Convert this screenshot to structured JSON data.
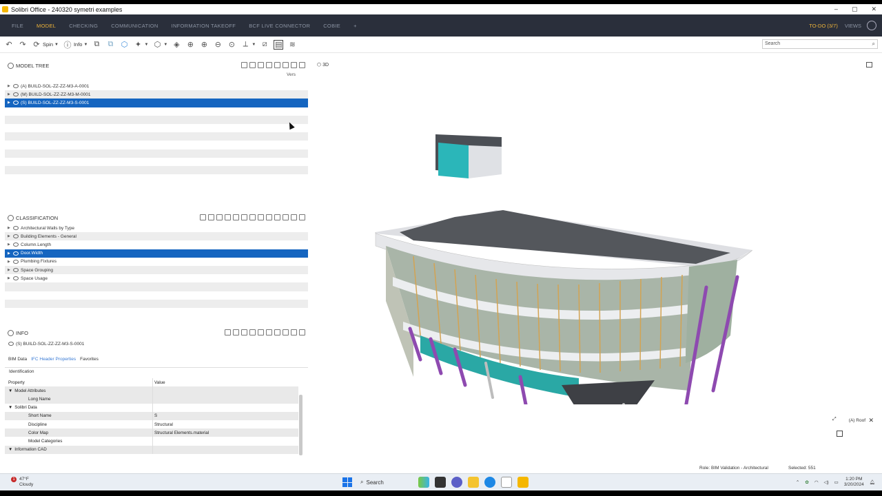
{
  "window": {
    "title": "Solibri Office - 240320 symetri examples",
    "controls": [
      "–",
      "▢",
      "✕"
    ]
  },
  "menubar": {
    "items": [
      "FILE",
      "MODEL",
      "CHECKING",
      "COMMUNICATION",
      "INFORMATION TAKEOFF",
      "BCF LIVE CONNECTOR",
      "COBIE",
      "+"
    ],
    "active_index": 1,
    "todo": "TO-DO (3/7)",
    "views": "VIEWS"
  },
  "toolbar": {
    "spin_label": "Spin",
    "info_label": "Info",
    "search_placeholder": "Search"
  },
  "model_tree": {
    "title": "MODEL TREE",
    "version_label": "Vers",
    "rows": [
      {
        "label": "(A) BUILD-SOL-ZZ-ZZ-M3-A-0001",
        "selected": false
      },
      {
        "label": "(M) BUILD-SOL-ZZ-ZZ-M3-M-0001",
        "selected": false
      },
      {
        "label": "(S) BUILD-SOL-ZZ-ZZ-M3-S-0001",
        "selected": true
      }
    ]
  },
  "classification": {
    "title": "CLASSIFICATION",
    "rows": [
      {
        "label": "Architectural Walls by Type",
        "selected": false
      },
      {
        "label": "Building Elements - General",
        "selected": false
      },
      {
        "label": "Column.Length",
        "selected": false
      },
      {
        "label": "Door.Width",
        "selected": true
      },
      {
        "label": "Plumbing Fixtures",
        "selected": false
      },
      {
        "label": "Space Grouping",
        "selected": false
      },
      {
        "label": "Space Usage",
        "selected": false
      }
    ]
  },
  "info": {
    "title": "INFO",
    "subject": "(S) BUILD-SOL-ZZ-ZZ-M3-S-0001",
    "tabs": [
      "BIM Data",
      "IFC Header Properties",
      "Favorites"
    ],
    "section": "Identification",
    "columns": [
      "Property",
      "Value"
    ],
    "rows": [
      {
        "level": 0,
        "expand": "▼",
        "property": "Model Attributes",
        "value": ""
      },
      {
        "level": 1,
        "expand": "",
        "property": "Long Name",
        "value": ""
      },
      {
        "level": 0,
        "expand": "▼",
        "property": "Solibri Data",
        "value": ""
      },
      {
        "level": 1,
        "expand": "",
        "property": "Short Name",
        "value": "S"
      },
      {
        "level": 1,
        "expand": "",
        "property": "Discipline",
        "value": "Structural"
      },
      {
        "level": 1,
        "expand": "",
        "property": "Color Map",
        "value": "Structural Elements.material"
      },
      {
        "level": 1,
        "expand": "",
        "property": "Model Categories",
        "value": ""
      },
      {
        "level": 0,
        "expand": "▼",
        "property": "Information CAD",
        "value": ""
      }
    ]
  },
  "view3d": {
    "label": "3D",
    "navcube_label": "(A) Roof"
  },
  "status": {
    "role": "Role: BIM Validation - Architectural",
    "selected": "Selected: 551"
  },
  "taskbar": {
    "weather_badge": "1",
    "temperature": "47°F",
    "condition": "Cloudy",
    "search_label": "Search",
    "time": "1:20 PM",
    "date": "3/20/2024"
  }
}
